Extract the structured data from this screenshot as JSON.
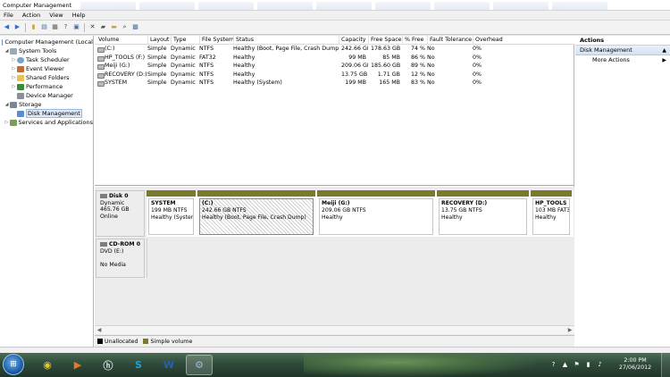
{
  "window": {
    "title": "Computer Management"
  },
  "menu": [
    "File",
    "Action",
    "View",
    "Help"
  ],
  "toolbar": {
    "icons": [
      "back-icon",
      "forward-icon",
      "up-icon",
      "show-hide-tree-icon",
      "properties-icon",
      "help-icon",
      "console-icon",
      "delete-icon",
      "drive-icon",
      "folder-icon",
      "search-icon",
      "disk-icon"
    ]
  },
  "tree": {
    "root": "Computer Management (Local",
    "items": [
      {
        "label": "System Tools",
        "level": 1,
        "expander": "◢",
        "icon": "tools"
      },
      {
        "label": "Task Scheduler",
        "level": 2,
        "expander": "▷",
        "icon": "clock"
      },
      {
        "label": "Event Viewer",
        "level": 2,
        "expander": "▷",
        "icon": "event"
      },
      {
        "label": "Shared Folders",
        "level": 2,
        "expander": "▷",
        "icon": "folder"
      },
      {
        "label": "Performance",
        "level": 2,
        "expander": "▷",
        "icon": "perf"
      },
      {
        "label": "Device Manager",
        "level": 2,
        "expander": "",
        "icon": "dev"
      },
      {
        "label": "Storage",
        "level": 1,
        "expander": "◢",
        "icon": "storage"
      },
      {
        "label": "Disk Management",
        "level": 2,
        "expander": "",
        "icon": "disk",
        "selected": true
      },
      {
        "label": "Services and Applications",
        "level": 1,
        "expander": "▷",
        "icon": "svc"
      }
    ]
  },
  "volumes": {
    "headers": {
      "volume": "Volume",
      "layout": "Layout",
      "type": "Type",
      "fs": "File System",
      "status": "Status",
      "capacity": "Capacity",
      "free": "Free Space",
      "pct": "% Free",
      "ft": "Fault Tolerance",
      "overhead": "Overhead"
    },
    "rows": [
      {
        "volume": "(C:)",
        "layout": "Simple",
        "type": "Dynamic",
        "fs": "NTFS",
        "status": "Healthy (Boot, Page File, Crash Dump)",
        "capacity": "242.66 GB",
        "free": "178.63 GB",
        "pct": "74 %",
        "ft": "No",
        "overhead": "0%"
      },
      {
        "volume": "HP_TOOLS (F:)",
        "layout": "Simple",
        "type": "Dynamic",
        "fs": "FAT32",
        "status": "Healthy",
        "capacity": "99 MB",
        "free": "85 MB",
        "pct": "86 %",
        "ft": "No",
        "overhead": "0%"
      },
      {
        "volume": "Meiji (G:)",
        "layout": "Simple",
        "type": "Dynamic",
        "fs": "NTFS",
        "status": "Healthy",
        "capacity": "209.06 GB",
        "free": "185.60 GB",
        "pct": "89 %",
        "ft": "No",
        "overhead": "0%"
      },
      {
        "volume": "RECOVERY (D:)",
        "layout": "Simple",
        "type": "Dynamic",
        "fs": "NTFS",
        "status": "Healthy",
        "capacity": "13.75 GB",
        "free": "1.71 GB",
        "pct": "12 %",
        "ft": "No",
        "overhead": "0%"
      },
      {
        "volume": "SYSTEM",
        "layout": "Simple",
        "type": "Dynamic",
        "fs": "NTFS",
        "status": "Healthy (System)",
        "capacity": "199 MB",
        "free": "165 MB",
        "pct": "83 %",
        "ft": "No",
        "overhead": "0%"
      }
    ]
  },
  "disks": [
    {
      "name": "Disk 0",
      "lines": [
        "Dynamic",
        "465.76 GB",
        "Online"
      ],
      "partitions": [
        {
          "name": "SYSTEM",
          "line1": "199 MB NTFS",
          "line2": "Healthy (System)",
          "share": 0.12,
          "hatched": false
        },
        {
          "name": "(C:)",
          "line1": "242.66 GB NTFS",
          "line2": "Healthy (Boot, Page File, Crash Dump)",
          "share": 0.28,
          "hatched": true
        },
        {
          "name": "Meiji  (G:)",
          "line1": "209.06 GB NTFS",
          "line2": "Healthy",
          "share": 0.28,
          "hatched": false
        },
        {
          "name": "RECOVERY  (D:)",
          "line1": "13.75 GB NTFS",
          "line2": "Healthy",
          "share": 0.22,
          "hatched": false
        },
        {
          "name": "HP_TOOLS  (F:",
          "line1": "103 MB FAT32",
          "line2": "Healthy",
          "share": 0.1,
          "hatched": false
        }
      ]
    },
    {
      "name": "CD-ROM 0",
      "lines": [
        "DVD (E:)",
        "",
        "No Media"
      ]
    }
  ],
  "legend": [
    {
      "label": "Unallocated",
      "color": "#000000"
    },
    {
      "label": "Simple volume",
      "color": "#7b7a2c"
    }
  ],
  "actions": {
    "header": "Actions",
    "section": "Disk Management",
    "items": [
      "More Actions"
    ]
  },
  "taskbar": {
    "apps": [
      {
        "name": "chrome",
        "glyph": "◉",
        "color": "#e8c23a"
      },
      {
        "name": "media-player",
        "glyph": "▶",
        "color": "#e07b22"
      },
      {
        "name": "hp-app",
        "glyph": "ⓗ",
        "color": "#cfd8df"
      },
      {
        "name": "skype",
        "glyph": "S",
        "color": "#17a3e0"
      },
      {
        "name": "word",
        "glyph": "W",
        "color": "#2b5fb3"
      },
      {
        "name": "computer-management",
        "glyph": "⚙",
        "color": "#9fb8d6",
        "active": true
      }
    ],
    "time": "2:00 PM",
    "date": "27/06/2012"
  },
  "colors": {
    "simple_volume": "#7b7a2c",
    "selection": "#dfe9f7"
  }
}
